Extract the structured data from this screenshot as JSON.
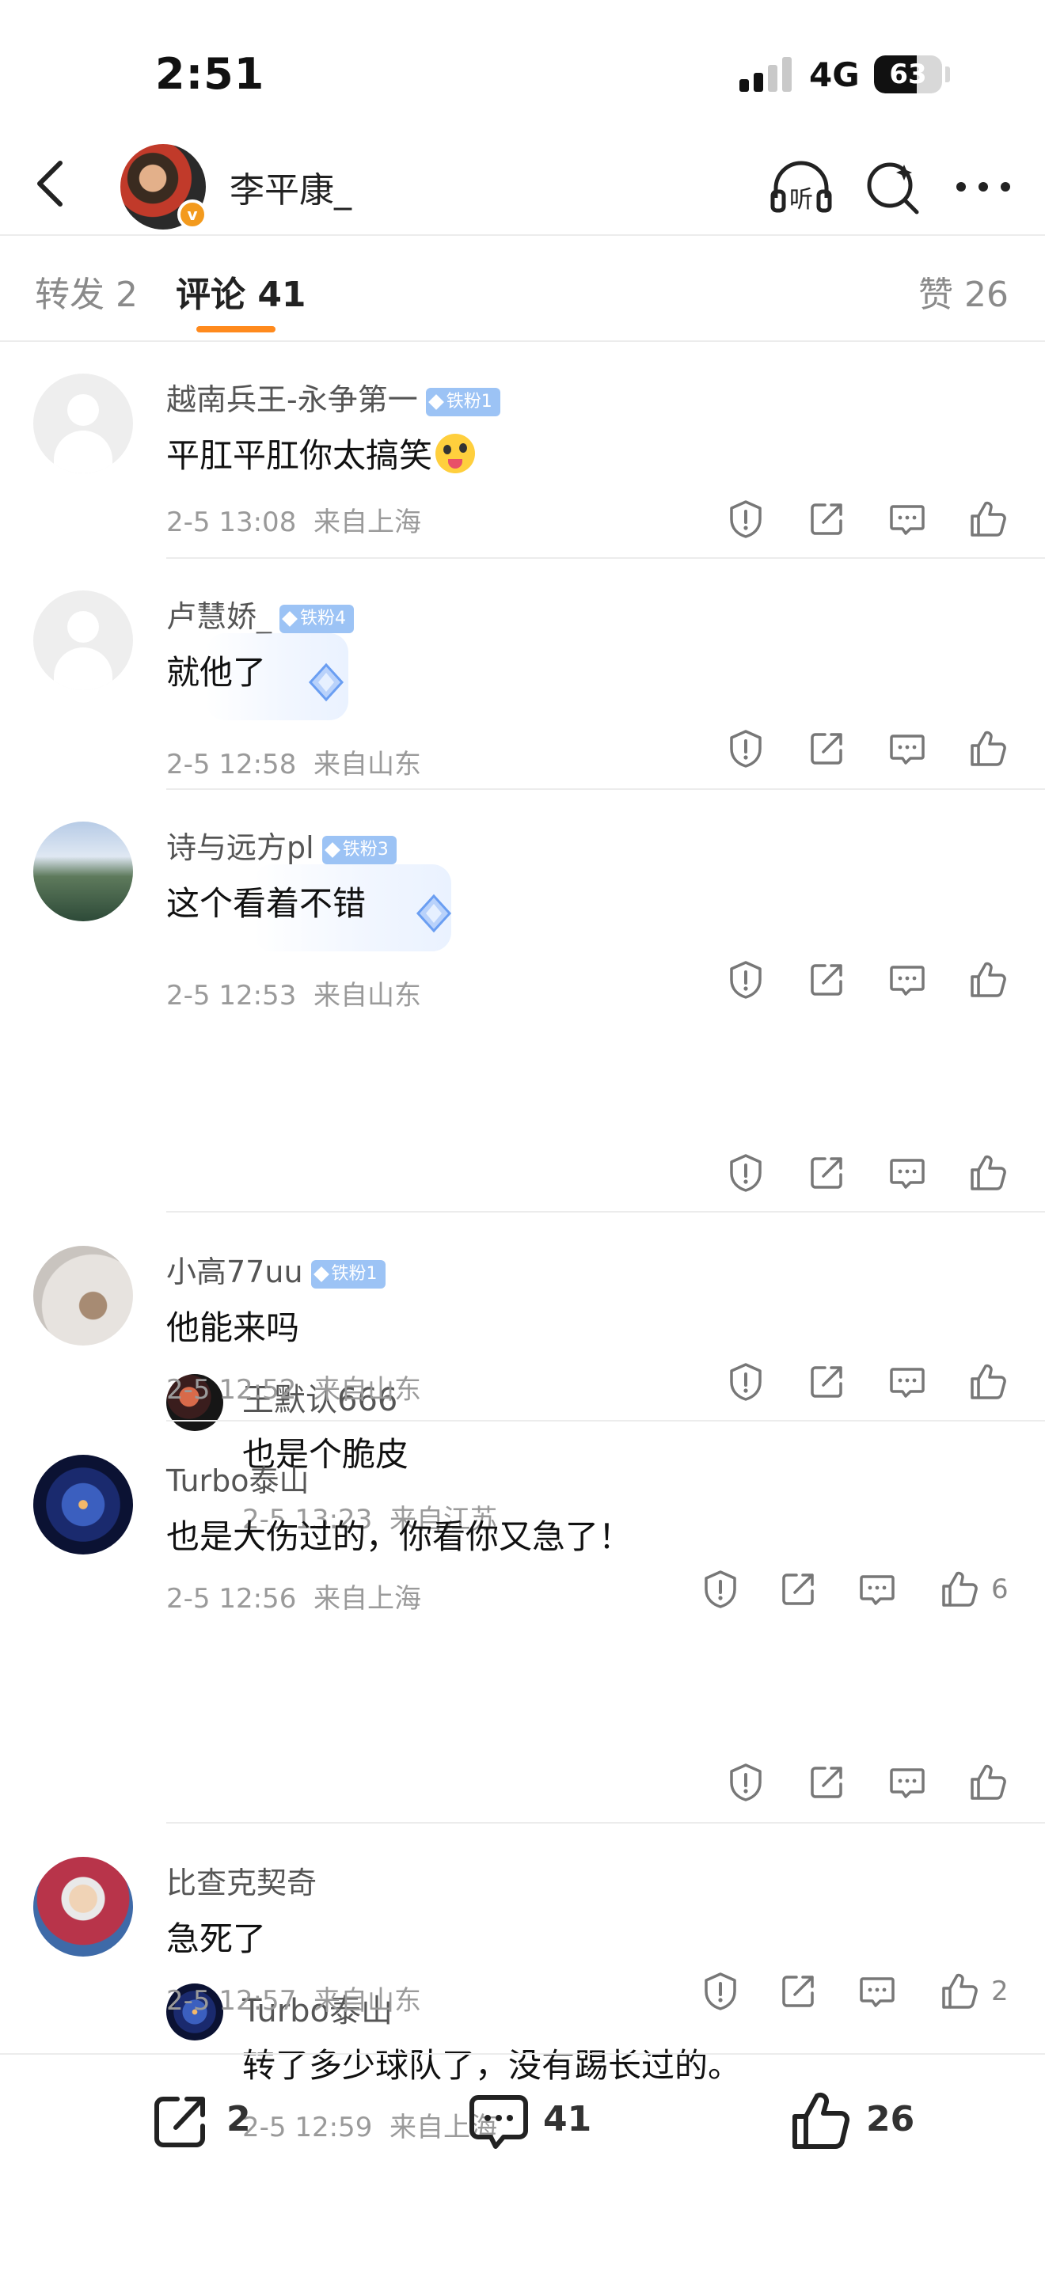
{
  "status_bar": {
    "time": "2:51",
    "network": "4G",
    "battery": "63",
    "battery_level": 0.63
  },
  "header": {
    "title": "李平康_"
  },
  "tabs": {
    "repost": "转发 2",
    "comments": "评论 41",
    "likes": "赞 26"
  },
  "colors": {
    "accent": "#ff8a1d",
    "fan_badge": "#9cc3f5",
    "verified": "#f39a1d"
  },
  "comments": [
    {
      "user": "越南兵王-永争第一",
      "badge": "铁粉1",
      "text": "平肛平肛你太搞笑",
      "emoji": "grinning-tongue-emoji",
      "time": "2-5 13:08",
      "location": "来自上海",
      "likes": ""
    },
    {
      "user": "卢慧娇_",
      "badge": "铁粉4",
      "text": "就他了",
      "time": "2-5 12:58",
      "location": "来自山东",
      "likes": ""
    },
    {
      "user": "诗与远方pl",
      "badge": "铁粉3",
      "text": "这个看着不错",
      "time": "2-5 12:53",
      "location": "来自山东",
      "likes": "",
      "reply": {
        "user": "王默认666",
        "text": "也是个脆皮",
        "time": "2-5 13:23",
        "location": "来自江苏"
      }
    },
    {
      "user": "小高77uu",
      "badge": "铁粉1",
      "text": "他能来吗",
      "time": "2-5 12:52",
      "location": "来自山东",
      "likes": ""
    },
    {
      "user": "Turbo泰山",
      "badge": "",
      "text": "也是大伤过的，你看你又急了！",
      "time": "2-5 12:56",
      "location": "来自上海",
      "likes": "6",
      "reply": {
        "user": "Turbo泰山",
        "text": "转了多少球队了，没有踢长过的。",
        "time": "2-5 12:59",
        "location": "来自上海"
      }
    },
    {
      "user": "比查克契奇",
      "badge": "",
      "text": "急死了",
      "time": "2-5 12:57",
      "location": "来自山东",
      "likes": "2"
    }
  ],
  "bottom_bar": {
    "reposts": "2",
    "comments": "41",
    "likes": "26"
  }
}
